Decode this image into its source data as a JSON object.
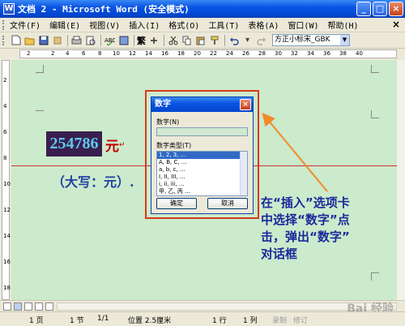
{
  "window": {
    "title": "文档 2 - Microsoft Word (安全模式)",
    "app_icon": "W"
  },
  "menus": [
    "文件(F)",
    "编辑(E)",
    "视图(V)",
    "插入(I)",
    "格式(O)",
    "工具(T)",
    "表格(A)",
    "窗口(W)",
    "帮助(H)"
  ],
  "toolbar": {
    "trad_label": "繁",
    "font_name": "方正小标宋_GBK"
  },
  "ruler": {
    "h_numbers": [
      "2",
      "2",
      "4",
      "6",
      "8",
      "10",
      "12",
      "14",
      "16",
      "18",
      "20",
      "22",
      "24",
      "26",
      "28",
      "30",
      "32",
      "34",
      "36",
      "38",
      "40"
    ],
    "v_numbers": [
      "2",
      "4",
      "6",
      "8",
      "10",
      "12",
      "14",
      "16",
      "18"
    ]
  },
  "document": {
    "number_text": "254786",
    "yuan_text": "元",
    "para_mark": "↵",
    "daxie_text": "（大写：元）."
  },
  "dialog": {
    "title": "数字",
    "close_glyph": "×",
    "number_label": "数字(N)",
    "type_label": "数字类型(T)",
    "list_items": [
      "1, 2, 3, ...",
      "A, B, C, ...",
      "a, b, c, ...",
      "I, II, III, ...",
      "i, ii, iii, ...",
      "甲, 乙, 丙 ..."
    ],
    "ok_label": "确定",
    "cancel_label": "取消"
  },
  "annotation": {
    "lines": [
      "在“插入”选项卡",
      "中选择“数字”点",
      "击，弹出“数字”",
      "对话框"
    ]
  },
  "status": {
    "page": "1 页",
    "section": "1 节",
    "page_of": "1/1",
    "position": "位置 2.5厘米",
    "line": "1 行",
    "column": "1 列",
    "record": "录制",
    "revise": "修订"
  },
  "watermark": "Bai 经验",
  "colors": {
    "title_bar": "#0a54e3",
    "document_bg": "#cceacc",
    "highlight_border": "#d63a1a",
    "annotation_text": "#1a2a9a",
    "number_bg": "#3a1f4e",
    "number_text": "#5ec8f0",
    "red_text": "#c00000"
  }
}
